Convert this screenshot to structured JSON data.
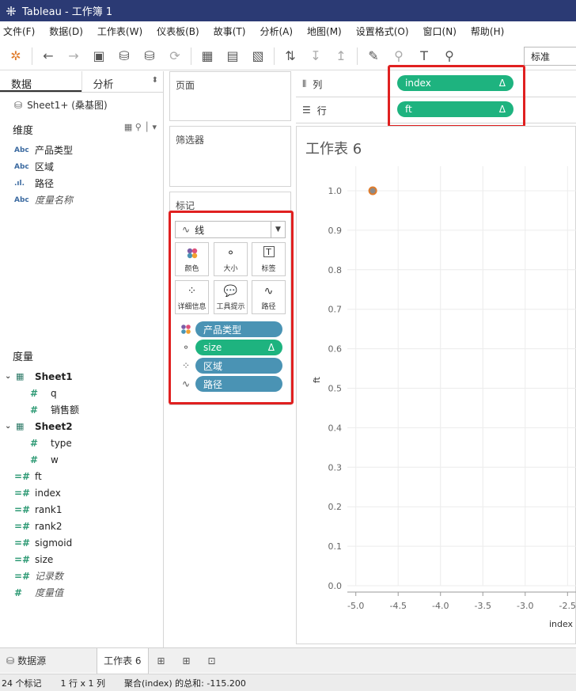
{
  "window": {
    "title": "Tableau - 工作簿 1"
  },
  "menu": [
    "文件(F)",
    "数据(D)",
    "工作表(W)",
    "仪表板(B)",
    "故事(T)",
    "分析(A)",
    "地图(M)",
    "设置格式(O)",
    "窗口(N)",
    "帮助(H)"
  ],
  "toolbar": {
    "fit_select": "标准"
  },
  "left": {
    "tab_data": "数据",
    "tab_analysis": "分析",
    "source": "Sheet1+ (桑基图)",
    "dimensions_header": "维度",
    "dimensions": [
      {
        "type": "Abc",
        "name": "产品类型"
      },
      {
        "type": "Abc",
        "name": "区域"
      },
      {
        "type": ".ıl.",
        "name": "路径"
      },
      {
        "type": "Abc",
        "name": "度量名称"
      }
    ],
    "measures_header": "度量",
    "groups": [
      {
        "name": "Sheet1",
        "fields": [
          "q",
          "销售额"
        ]
      },
      {
        "name": "Sheet2",
        "fields": [
          "type",
          "w"
        ]
      }
    ],
    "calc_fields": [
      "ft",
      "index",
      "rank1",
      "rank2",
      "sigmoid",
      "size"
    ],
    "measure_extra": [
      "记录数",
      "度量值"
    ]
  },
  "cards": {
    "pages": "页面",
    "filters": "筛选器",
    "marks": "标记",
    "mark_type": "线",
    "buttons": [
      "颜色",
      "大小",
      "标签",
      "详细信息",
      "工具提示",
      "路径"
    ],
    "pills": [
      {
        "label": "产品类型",
        "delta": ""
      },
      {
        "label": "size",
        "delta": "Δ"
      },
      {
        "label": "区域",
        "delta": ""
      },
      {
        "label": "路径",
        "delta": ""
      }
    ]
  },
  "shelves": {
    "columns_label": "列",
    "rows_label": "行",
    "columns_pill": "index",
    "rows_pill": "ft",
    "delta": "Δ"
  },
  "sheet": {
    "title": "工作表 6"
  },
  "chart_data": {
    "type": "scatter",
    "xlabel": "index",
    "ylabel": "ft",
    "xlim": [
      -5.1,
      -2.4
    ],
    "ylim": [
      0.0,
      1.0
    ],
    "x_ticks": [
      "-5.0",
      "-4.5",
      "-4.0",
      "-3.5",
      "-3.0",
      "-2.5"
    ],
    "y_ticks": [
      "0.0",
      "0.1",
      "0.2",
      "0.3",
      "0.4",
      "0.5",
      "0.6",
      "0.7",
      "0.8",
      "0.9",
      "1.0"
    ],
    "points": [
      {
        "x": -4.8,
        "y": 1.0
      }
    ],
    "grid": true,
    "color": "#e07b2a"
  },
  "bottom": {
    "datasource_tab": "数据源",
    "sheet_tab": "工作表 6"
  },
  "status": {
    "marks": "24 个标记",
    "dims": "1 行 x 1 列",
    "sum": "聚合(index) 的总和: -115.200"
  }
}
